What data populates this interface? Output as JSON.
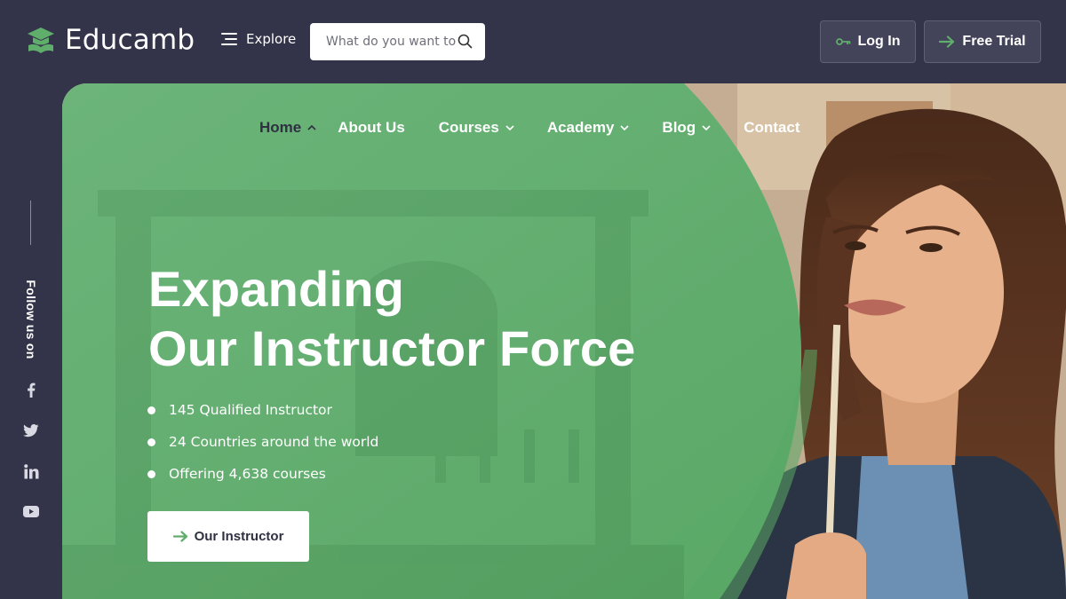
{
  "brand": {
    "name": "Educamb"
  },
  "header": {
    "explore_label": "Explore",
    "search_placeholder": "What do you want to learn?",
    "login_label": "Log In",
    "trial_label": "Free Trial"
  },
  "nav": {
    "items": [
      {
        "label": "Home",
        "active": true,
        "dropdown": true
      },
      {
        "label": "About Us",
        "dropdown": false
      },
      {
        "label": "Courses",
        "dropdown": true
      },
      {
        "label": "Academy",
        "dropdown": true
      },
      {
        "label": "Blog",
        "dropdown": true
      },
      {
        "label": "Contact",
        "dropdown": false
      }
    ]
  },
  "sidebar": {
    "follow_label": "Follow us on",
    "social_icons": [
      "facebook-icon",
      "twitter-icon",
      "linkedin-icon",
      "youtube-icon"
    ]
  },
  "hero": {
    "title_line1": "Expanding",
    "title_line2": "Our Instructor Force",
    "bullets": [
      "145 Qualified Instructor",
      "24 Countries around the world",
      "Offering 4,638 courses"
    ],
    "cta_label": "Our Instructor"
  },
  "colors": {
    "background": "#33334a",
    "accent_green": "#5fae6b",
    "button_text": "#2f3042"
  }
}
